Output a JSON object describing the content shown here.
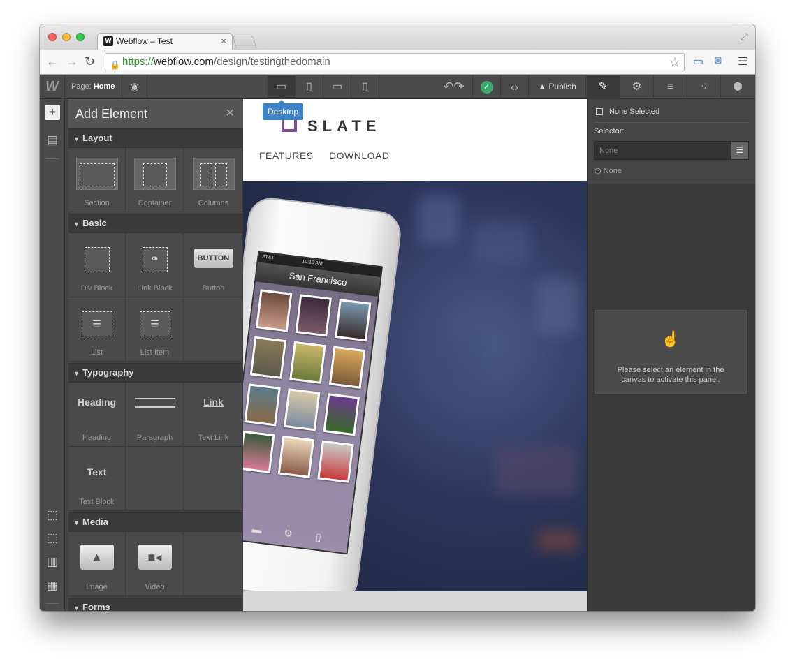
{
  "browser": {
    "tab_title": "Webflow – Test",
    "tab_favicon": "W",
    "url_scheme": "https://",
    "url_host": "webflow.com",
    "url_path": "/design/testingthedomain"
  },
  "toolbar": {
    "page_label": "Page:",
    "page_name": "Home",
    "tooltip": "Desktop",
    "publish": "Publish"
  },
  "add_element": {
    "title": "Add Element",
    "sections": {
      "layout": "Layout",
      "basic": "Basic",
      "typography": "Typography",
      "media": "Media",
      "forms": "Forms"
    },
    "items": {
      "section": "Section",
      "container": "Container",
      "columns": "Columns",
      "div_block": "Div Block",
      "link_block": "Link Block",
      "button": "Button",
      "button_icon": "BUTTON",
      "list": "List",
      "list_item": "List Item",
      "heading": "Heading",
      "heading_icon": "Heading",
      "paragraph": "Paragraph",
      "text_link": "Text Link",
      "text_link_icon": "Link",
      "text_block": "Text Block",
      "text_block_icon": "Text",
      "image": "Image",
      "video": "Video"
    }
  },
  "site": {
    "logo_text": "SLATE",
    "nav": [
      "FEATURES",
      "DOWNLOAD"
    ],
    "phone_carrier": "AT&T",
    "phone_time": "10:13 AM",
    "phone_title": "San Francisco"
  },
  "right_panel": {
    "none_selected": "None Selected",
    "selector_label": "Selector:",
    "selector_placeholder": "None",
    "state": "None",
    "hint": "Please select an element in the canvas to activate this panel."
  },
  "colors": {
    "accent_blue": "#3e82c4",
    "publish_check": "#3bab6c",
    "logo_purple": "#7b4c8e"
  }
}
